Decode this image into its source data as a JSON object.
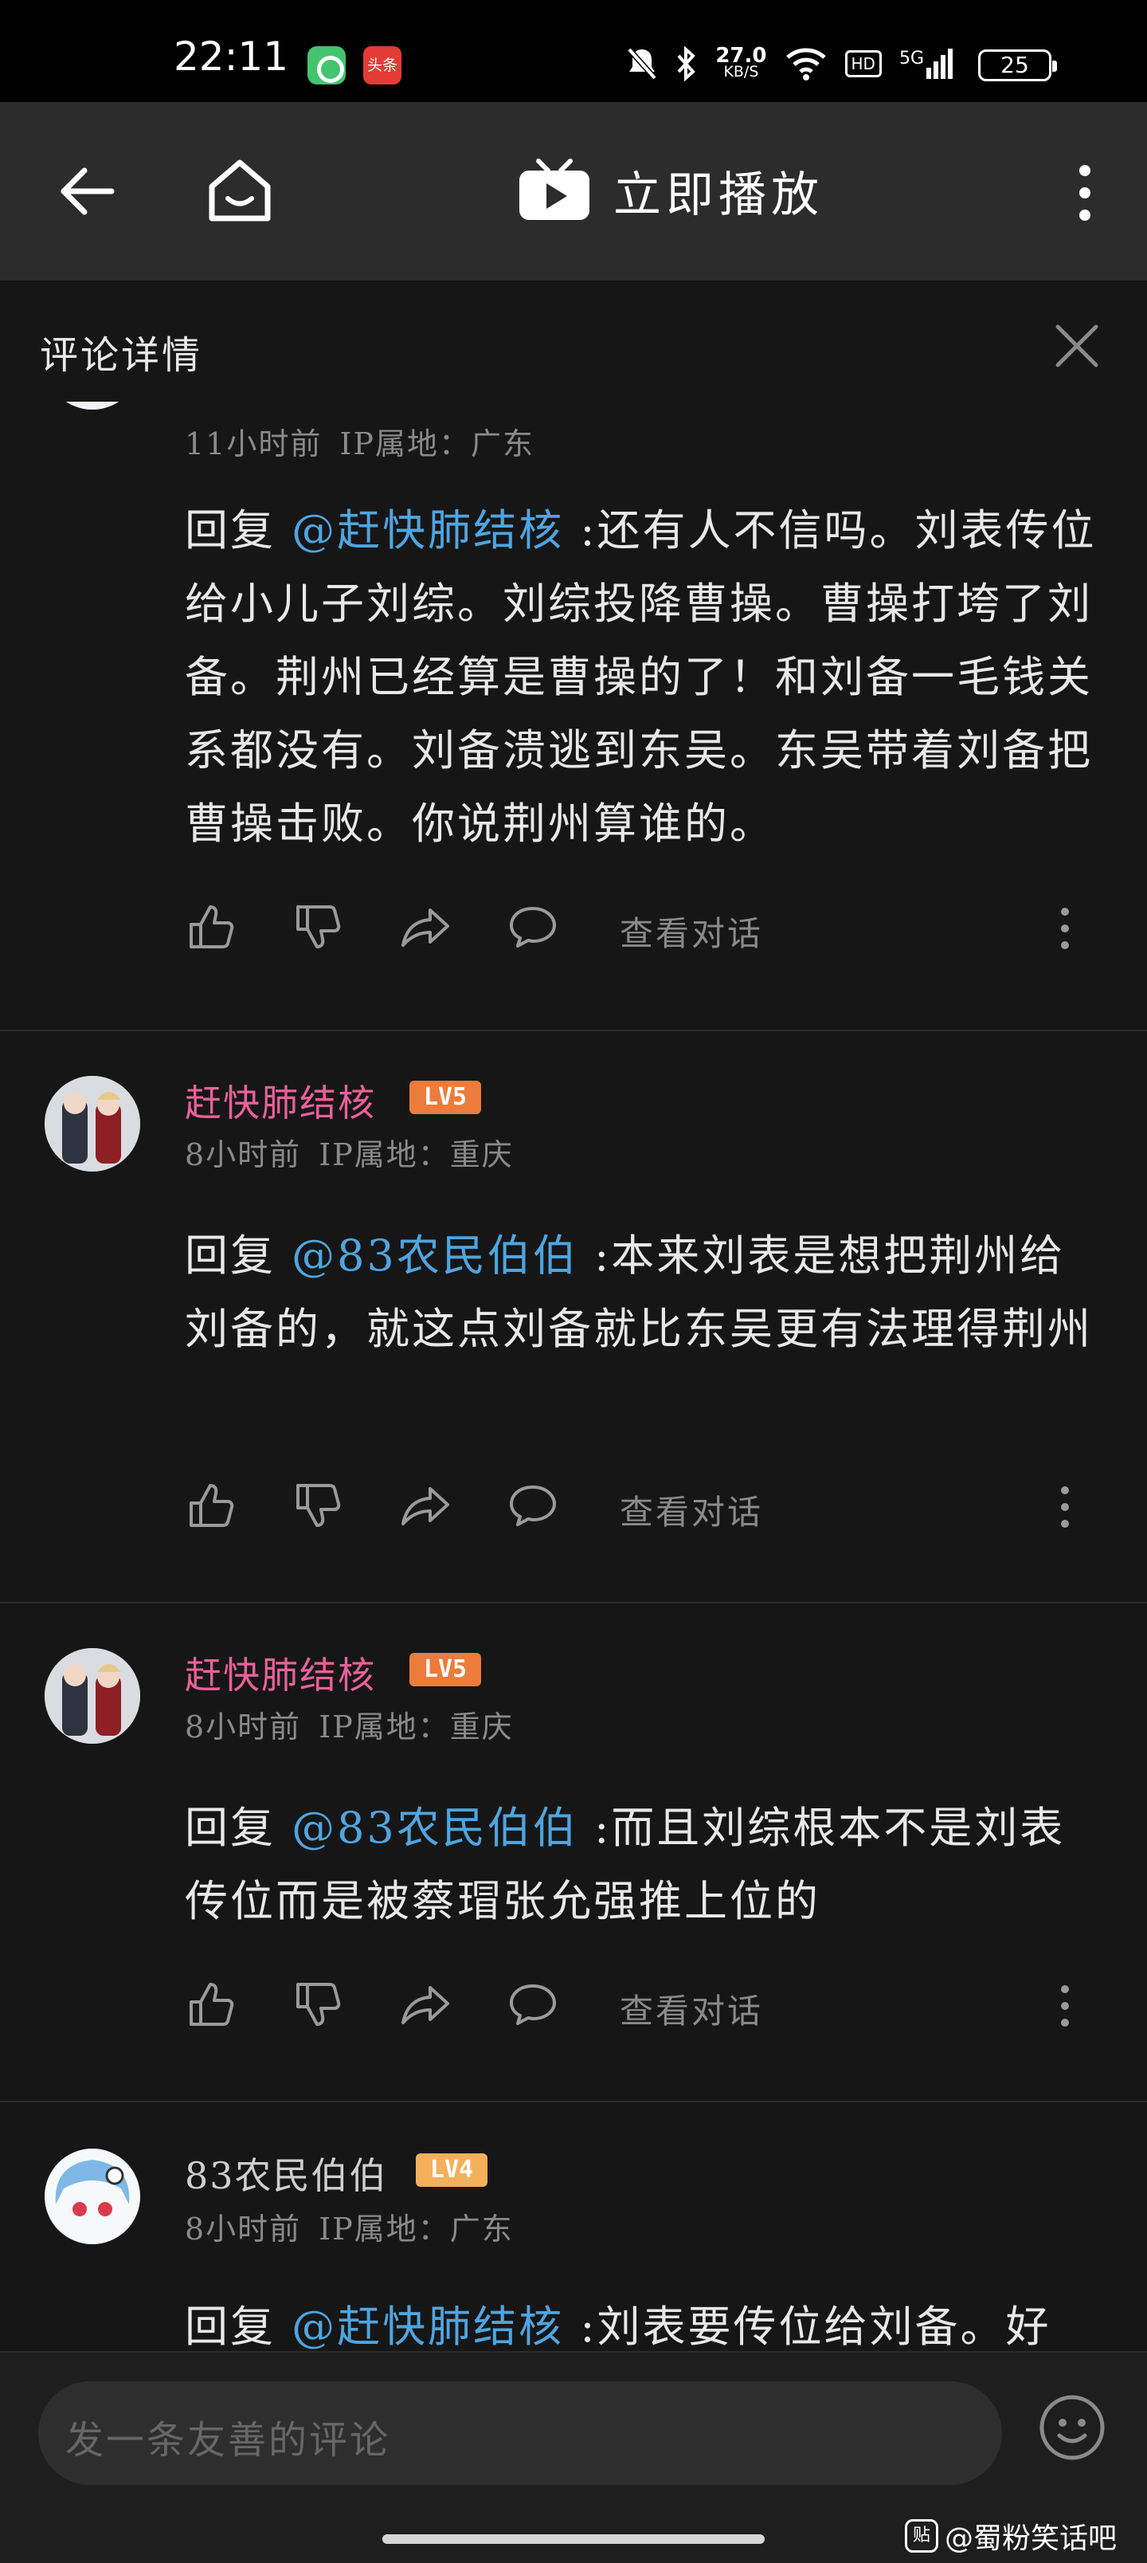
{
  "status_bar": {
    "time": "22:11",
    "app2_label": "头条",
    "net_speed_value": "27.0",
    "net_speed_unit": "KB/S",
    "hd": "HD",
    "signal": "5G",
    "battery": "25"
  },
  "top_nav": {
    "title": "立即播放"
  },
  "detail": {
    "title": "评论详情"
  },
  "comments": [
    {
      "time": "11小时前",
      "ip": "IP属地：广东",
      "reply_prefix": "回复",
      "mention": "@赶快肺结核",
      "text": ":还有人不信吗。刘表传位给小儿子刘综。刘综投降曹操。曹操打垮了刘备。荆州已经算是曹操的了！和刘备一毛钱关系都没有。刘备溃逃到东吴。东吴带着刘备把曹操击败。你说荆州算谁的。",
      "view_conversation": "查看对话"
    },
    {
      "username": "赶快肺结核",
      "level": "LV5",
      "time": "8小时前",
      "ip": "IP属地：重庆",
      "reply_prefix": "回复",
      "mention": "@83农民伯伯",
      "text": ":本来刘表是想把荆州给刘备的，就这点刘备就比东吴更有法理得荆州",
      "view_conversation": "查看对话"
    },
    {
      "username": "赶快肺结核",
      "level": "LV5",
      "time": "8小时前",
      "ip": "IP属地：重庆",
      "reply_prefix": "回复",
      "mention": "@83农民伯伯",
      "text": ":而且刘综根本不是刘表传位而是被蔡瑁张允强推上位的",
      "view_conversation": "查看对话"
    },
    {
      "username": "83农民伯伯",
      "level": "LV4",
      "time": "8小时前",
      "ip": "IP属地：广东",
      "reply_prefix": "回复",
      "mention": "@赶快肺结核",
      "text": ":刘表要传位给刘备。好"
    }
  ],
  "input": {
    "placeholder": "发一条友善的评论"
  },
  "watermark": {
    "logo": "贴",
    "text": "@蜀粉笑话吧"
  },
  "colors": {
    "background": "#161616",
    "nav_background": "#2c2c2c",
    "username_pink": "#e9619a",
    "mention_blue": "#4ea5e0",
    "lv5": "#ec7b3c",
    "lv4": "#f4b05a"
  }
}
